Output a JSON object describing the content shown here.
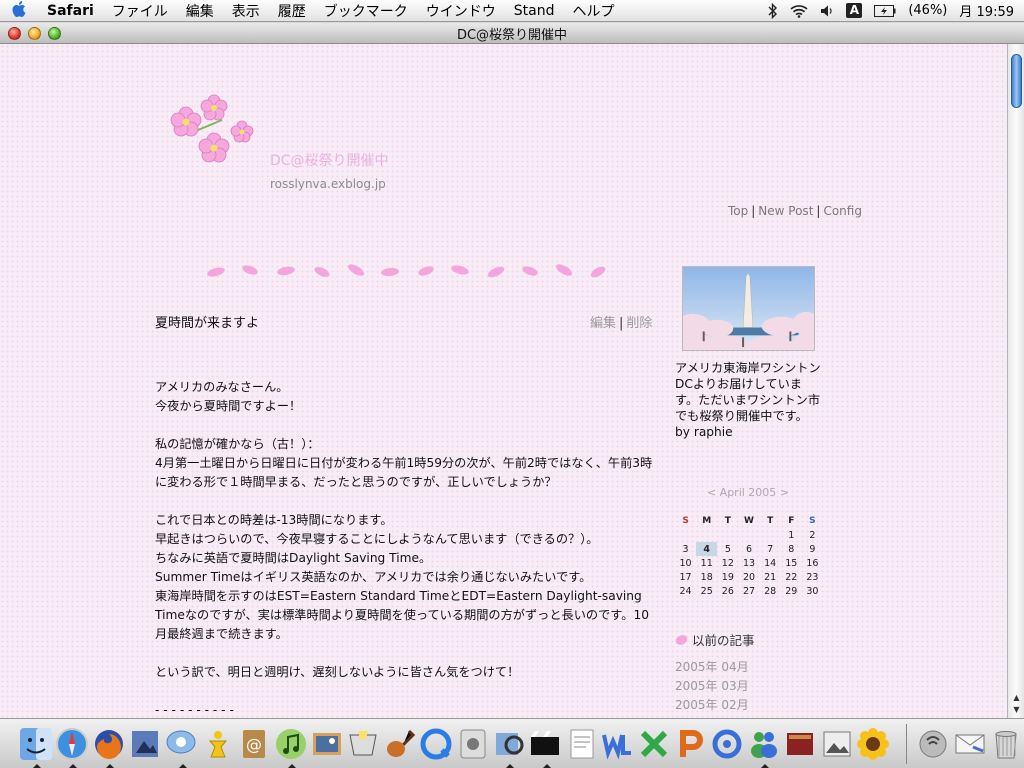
{
  "menubar": {
    "app": "Safari",
    "items": [
      "ファイル",
      "編集",
      "表示",
      "履歴",
      "ブックマーク",
      "ウインドウ",
      "Stand",
      "ヘルプ"
    ],
    "input_mode": "A",
    "battery": "(46%)",
    "clock": "月 19:59"
  },
  "window": {
    "title": "DC@桜祭り開催中"
  },
  "blog": {
    "title": "DC@桜祭り開催中",
    "url": "rosslynva.exblog.jp",
    "links": {
      "top": "Top",
      "new_post": "New Post",
      "config": "Config"
    }
  },
  "post": {
    "title": "夏時間が来ますよ",
    "edit": "編集",
    "delete": "削除",
    "body": [
      "アメリカのみなさーん。",
      "今夜から夏時間ですよー！",
      "",
      "私の記憶が確かなら（古！）：",
      "4月第一土曜日から日曜日に日付が変わる午前1時59分の次が、午前2時ではなく、午前3時に変わる形で１時間早まる、だったと思うのですが、正しいでしょうか？",
      "",
      "これで日本との時差は-13時間になります。",
      "早起きはつらいので、今夜早寝することにしようなんて思います（できるの？）。",
      "ちなみに英語で夏時間はDaylight Saving Time。",
      "Summer Timeはイギリス英語なのか、アメリカでは余り通じないみたいです。",
      "東海岸時間を示すのはEST=Eastern Standard TimeとEDT=Eastern Daylight-saving Timeなのですが、実は標準時間より夏時間を使っている期間の方がずっと長いのです。10月最終週まで続きます。",
      "",
      "という訳で、明日と週明け、遅刻しないように皆さん気をつけて！",
      "",
      "- - - - - - - - - -"
    ]
  },
  "sidebar": {
    "description": "アメリカ東海岸ワシントンDCよりお届けしています。ただいまワシントン市でも桜祭り開催中です。",
    "author": "by raphie",
    "calendar": {
      "prev": "<",
      "month": "April 2005",
      "next": ">",
      "weekdays": [
        "S",
        "M",
        "T",
        "W",
        "T",
        "F",
        "S"
      ],
      "weeks": [
        [
          "",
          "",
          "",
          "",
          "",
          "1",
          "2"
        ],
        [
          "3",
          "4",
          "5",
          "6",
          "7",
          "8",
          "9"
        ],
        [
          "10",
          "11",
          "12",
          "13",
          "14",
          "15",
          "16"
        ],
        [
          "17",
          "18",
          "19",
          "20",
          "21",
          "22",
          "23"
        ],
        [
          "24",
          "25",
          "26",
          "27",
          "28",
          "29",
          "30"
        ]
      ],
      "today": "4"
    },
    "archive_heading": "以前の記事",
    "archive": [
      "2005年 04月",
      "2005年 03月",
      "2005年 02月"
    ]
  },
  "dock": {
    "icons": [
      "finder-icon",
      "safari-icon",
      "firefox-icon",
      "preview-icon",
      "ichat-icon",
      "aim-icon",
      "address-book-icon",
      "itunes-icon",
      "iphoto-icon",
      "imovie-icon",
      "garageband-icon",
      "quicktime-icon",
      "system-prefs-icon",
      "preview2-icon",
      "dvd-icon",
      "textedit-icon",
      "word-icon",
      "excel-icon",
      "powerpoint-icon",
      "entourage-icon",
      "messenger-icon",
      "dictionary-icon",
      "photo-icon",
      "sunflower-icon",
      "network-icon",
      "mail-icon",
      "trash-icon"
    ]
  },
  "colors": {
    "page_bg": "#f8ecf6",
    "title_pink": "#e7b4e0",
    "link_gray": "#7a7a7a"
  }
}
